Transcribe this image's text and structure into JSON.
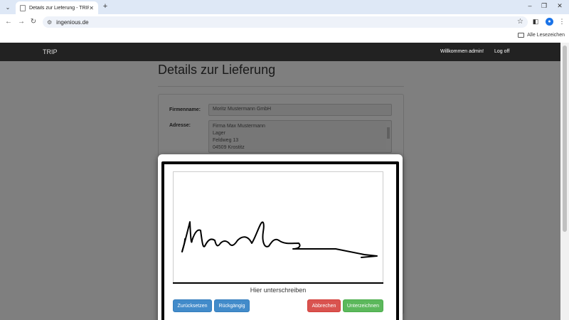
{
  "browser": {
    "tab_title": "Details zur Lieferung - TRIP",
    "url": "ingenious.de",
    "bookmarks_label": "Alle Lesezeichen"
  },
  "navbar": {
    "brand": "TRIP",
    "welcome": "Willkommen admin!",
    "logoff": "Log off"
  },
  "page": {
    "title": "Details zur Lieferung",
    "company_label": "Firmenname:",
    "company_value": "Moritz  Mustermann GmbH",
    "address_label": "Adresse:",
    "address_lines": [
      "Firma Max Mustermann",
      "Lager",
      "Feldweg 13",
      "04509 Krostitz"
    ]
  },
  "signature_modal": {
    "hint": "Hier unterschreiben",
    "reset_label": "Zurücksetzen",
    "undo_label": "Rückgängig",
    "cancel_label": "Abbrechen",
    "sign_label": "Unterzeichnen"
  }
}
